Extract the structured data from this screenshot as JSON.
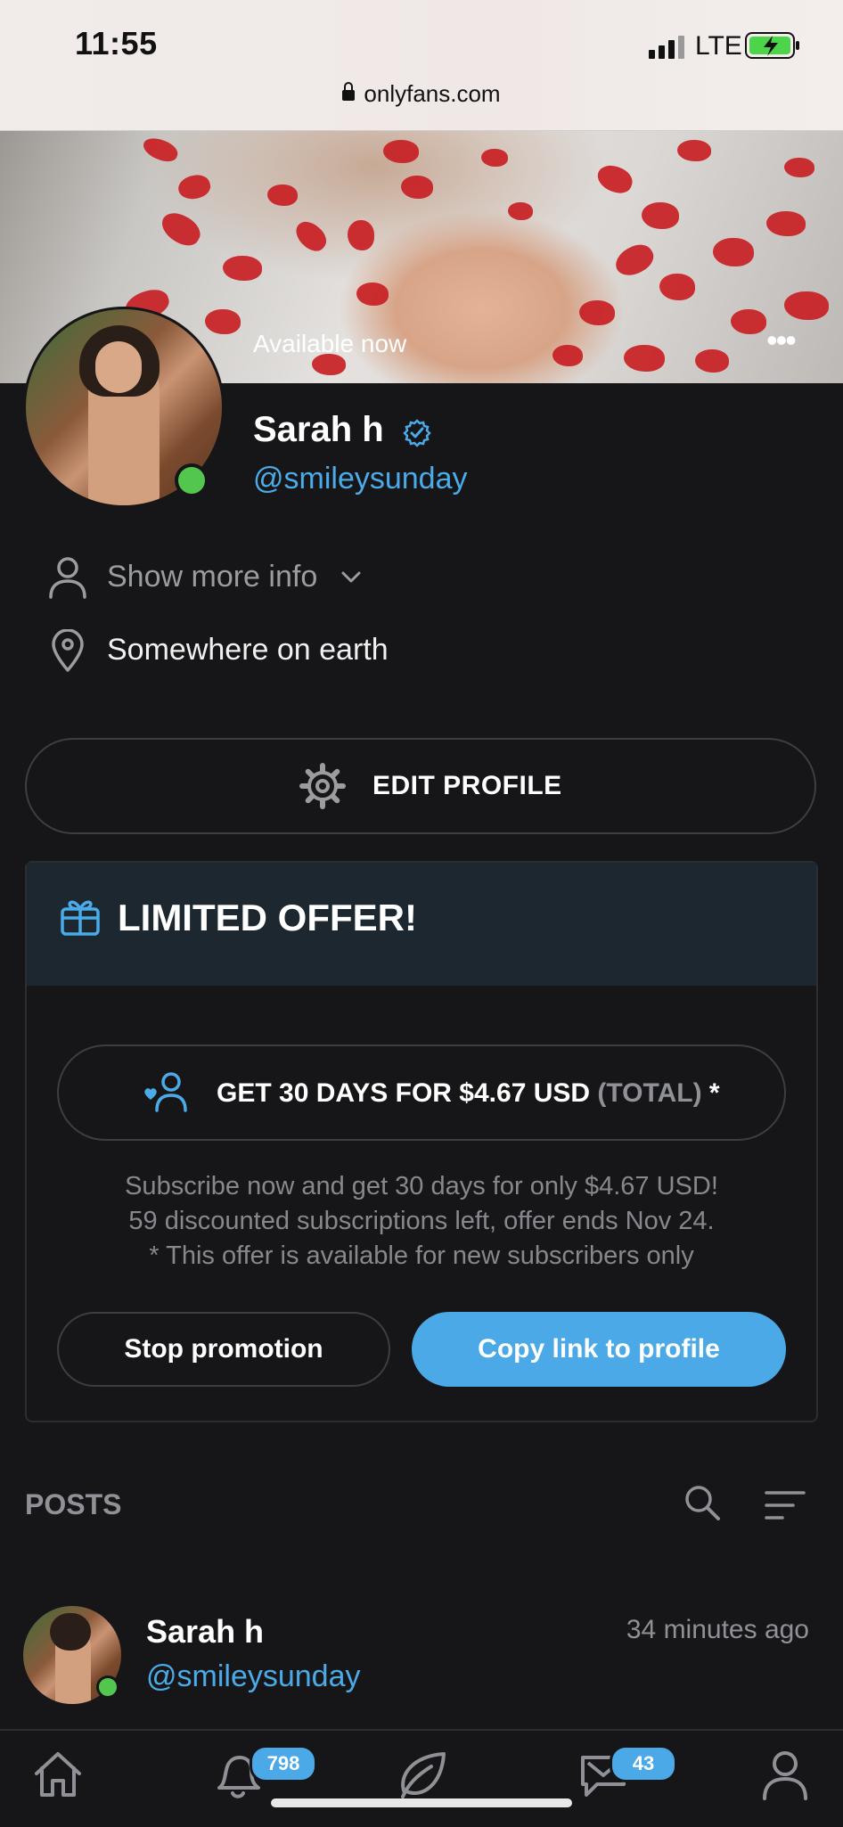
{
  "status_bar": {
    "time": "11:55",
    "network": "LTE",
    "url": "onlyfans.com"
  },
  "profile": {
    "availability": "Available now",
    "more_menu": "•••",
    "name": "Sarah h",
    "handle": "@smileysunday",
    "show_more_info": "Show more info",
    "location": "Somewhere on earth",
    "edit_profile": "EDIT PROFILE"
  },
  "offer": {
    "title": "LIMITED OFFER!",
    "subscribe_main": "GET 30 DAYS FOR $4.67 USD ",
    "subscribe_total": "(TOTAL)",
    "subscribe_star": " *",
    "desc_line1": "Subscribe now and get 30 days for only $4.67 USD!",
    "desc_line2": "59 discounted subscriptions left, offer ends Nov 24.",
    "desc_line3": "* This offer is available for new subscribers only",
    "stop_promotion": "Stop promotion",
    "copy_link": "Copy link to profile"
  },
  "posts": {
    "label": "POSTS",
    "first_post": {
      "name": "Sarah h",
      "handle": "@smileysunday",
      "time": "34 minutes ago"
    }
  },
  "nav": {
    "notifications_badge": "798",
    "messages_badge": "43"
  },
  "colors": {
    "accent": "#4aa9e6",
    "online": "#53c64e",
    "background": "#161618"
  }
}
